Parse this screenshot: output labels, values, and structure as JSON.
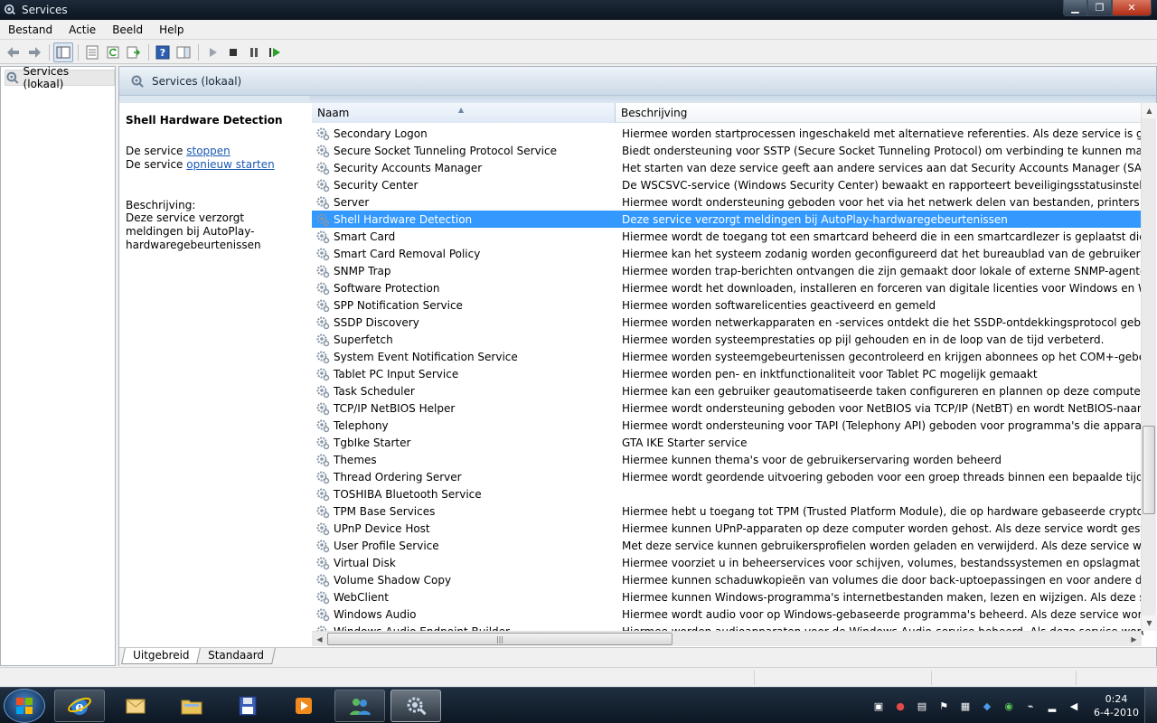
{
  "window": {
    "title": "Services"
  },
  "menu": [
    "Bestand",
    "Actie",
    "Beeld",
    "Help"
  ],
  "tree": {
    "root_label": "Services (lokaal)"
  },
  "pane": {
    "header_label": "Services (lokaal)"
  },
  "detail": {
    "service_name": "Shell Hardware Detection",
    "action1_prefix": "De service ",
    "action1_link": "stoppen",
    "action2_prefix": "De service ",
    "action2_link": "opnieuw starten",
    "description_label": "Beschrijving:",
    "description_text": "Deze service verzorgt meldingen bij AutoPlay-hardwaregebeurtenissen"
  },
  "list": {
    "columns": [
      "Naam",
      "Beschrijving"
    ],
    "selected_index": 5,
    "rows": [
      {
        "name": "Secondary Logon",
        "desc": "Hiermee worden startprocessen ingeschakeld met alternatieve referenties. Als deze service is gestopt, is dit type"
      },
      {
        "name": "Secure Socket Tunneling Protocol Service",
        "desc": "Biedt ondersteuning voor SSTP (Secure Socket Tunneling Protocol) om verbinding te kunnen maken met externe"
      },
      {
        "name": "Security Accounts Manager",
        "desc": "Het starten van deze service geeft aan andere services aan dat Security Accounts Manager (SAM) gereed is vo"
      },
      {
        "name": "Security Center",
        "desc": "De WSCSVC-service (Windows Security Center) bewaakt en rapporteert beveiligingsstatusinstellingen op de c"
      },
      {
        "name": "Server",
        "desc": "Hiermee wordt ondersteuning geboden voor het via het netwerk delen van bestanden, printers en named pip"
      },
      {
        "name": "Shell Hardware Detection",
        "desc": "Deze service verzorgt meldingen bij AutoPlay-hardwaregebeurtenissen"
      },
      {
        "name": "Smart Card",
        "desc": "Hiermee wordt de toegang tot een smartcard beheerd die in een smartcardlezer is geplaatst die aan de compu"
      },
      {
        "name": "Smart Card Removal Policy",
        "desc": "Hiermee kan het systeem zodanig worden geconfigureerd dat het bureaublad van de gebruiker wordt vergren"
      },
      {
        "name": "SNMP Trap",
        "desc": "Hiermee worden trap-berichten ontvangen die zijn gemaakt door lokale of externe SNMP-agenten en worder"
      },
      {
        "name": "Software Protection",
        "desc": "Hiermee wordt het downloaden, installeren en forceren van digitale licenties voor Windows en Windows-toep"
      },
      {
        "name": "SPP Notification Service",
        "desc": "Hiermee worden softwarelicenties geactiveerd en gemeld"
      },
      {
        "name": "SSDP Discovery",
        "desc": "Hiermee worden netwerkapparaten en -services ontdekt die het SSDP-ontdekkingsprotocol gebruiken, zoals U"
      },
      {
        "name": "Superfetch",
        "desc": "Hiermee worden systeemprestaties op pijl gehouden en in de loop van de tijd verbeterd."
      },
      {
        "name": "System Event Notification Service",
        "desc": "Hiermee worden systeemgebeurtenissen gecontroleerd en krijgen abonnees op het COM+-gebeurtenissystee"
      },
      {
        "name": "Tablet PC Input Service",
        "desc": "Hiermee worden pen- en inktfunctionaliteit voor Tablet PC mogelijk gemaakt"
      },
      {
        "name": "Task Scheduler",
        "desc": "Hiermee kan een gebruiker geautomatiseerde taken configureren en plannen op deze computer. De service fu"
      },
      {
        "name": "TCP/IP NetBIOS Helper",
        "desc": "Hiermee wordt ondersteuning geboden voor NetBIOS via TCP/IP (NetBT) en wordt NetBIOS-naamomzetting"
      },
      {
        "name": "Telephony",
        "desc": "Hiermee wordt ondersteuning voor TAPI (Telephony API) geboden voor programma's die apparaten voor tele"
      },
      {
        "name": "TgbIke Starter",
        "desc": "GTA IKE Starter service"
      },
      {
        "name": "Themes",
        "desc": "Hiermee kunnen thema's voor de gebruikerservaring worden beheerd"
      },
      {
        "name": "Thread Ordering Server",
        "desc": "Hiermee wordt geordende uitvoering geboden voor een groep threads binnen een bepaalde tijdsperiode"
      },
      {
        "name": "TOSHIBA Bluetooth Service",
        "desc": ""
      },
      {
        "name": "TPM Base Services",
        "desc": "Hiermee hebt u toegang tot TPM (Trusted Platform Module), die op hardware gebaseerde cryptografieservice"
      },
      {
        "name": "UPnP Device Host",
        "desc": "Hiermee kunnen UPnP-apparaten op deze computer worden gehost. Als deze service wordt gestopt, werkt ge"
      },
      {
        "name": "User Profile Service",
        "desc": "Met deze service kunnen gebruikersprofielen worden geladen en verwijderd. Als deze service wordt gestopt o"
      },
      {
        "name": "Virtual Disk",
        "desc": "Hiermee voorziet u in beheerservices voor schijven, volumes, bestandssystemen en opslagmatrices."
      },
      {
        "name": "Volume Shadow Copy",
        "desc": "Hiermee kunnen schaduwkopieën van volumes die door back-uptoepassingen en voor andere doeleinden wo"
      },
      {
        "name": "WebClient",
        "desc": "Hiermee kunnen Windows-programma's internetbestanden maken, lezen en wijzigen. Als deze service wordt"
      },
      {
        "name": "Windows Audio",
        "desc": "Hiermee wordt audio voor op Windows-gebaseerde programma's beheerd. Als deze service wordt gestopt, fu"
      },
      {
        "name": "Windows Audio Endpoint Builder",
        "desc": "Hiermee worden audioapparaten voor de Windows Audio-service beheerd. Als deze service wordt gestopt, fu"
      }
    ]
  },
  "tabs": [
    "Uitgebreid",
    "Standaard"
  ],
  "taskbar": {
    "clock_time": "0:24",
    "clock_date": "6-4-2010"
  },
  "colors": {
    "selection": "#3399ff",
    "link": "#1a58b5"
  }
}
